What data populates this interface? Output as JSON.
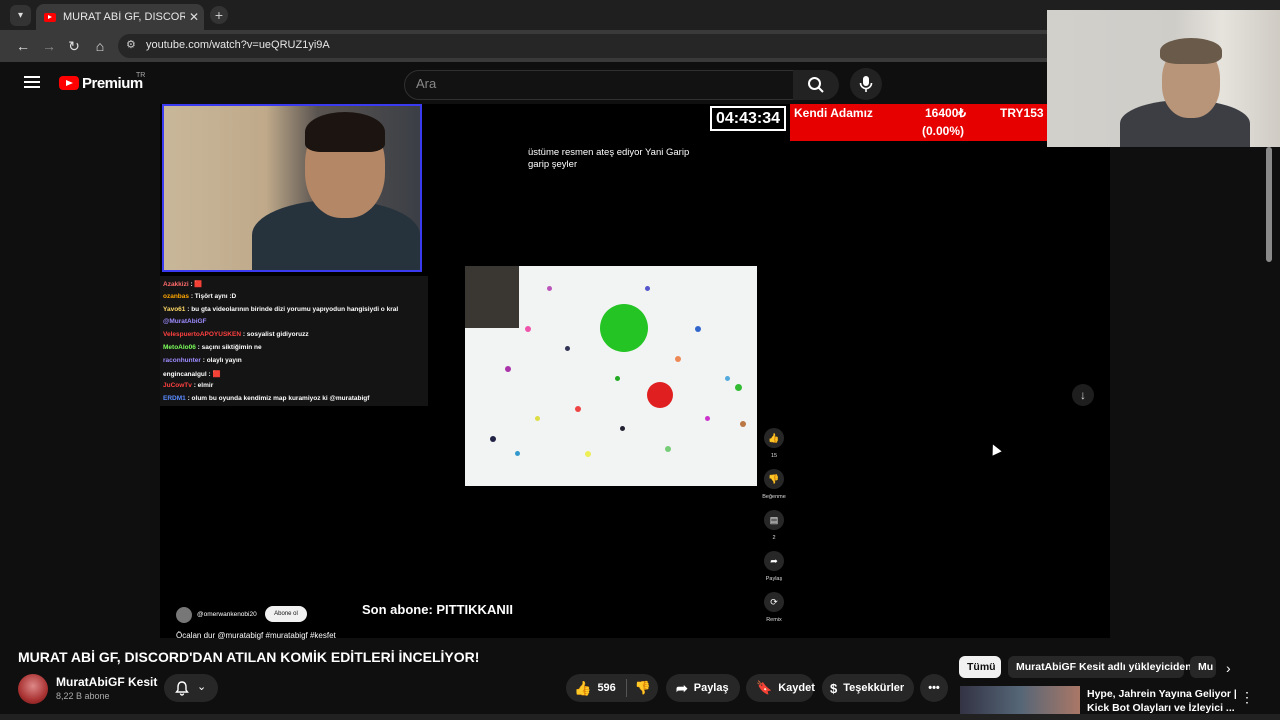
{
  "browser": {
    "tab_title": "MURAT ABİ GF, DISCORD'DAN AT...",
    "tab_close": "✕",
    "new_tab": "+",
    "url": "youtube.com/watch?v=ueQRUZ1yi9A",
    "back": "←",
    "forward": "→",
    "reload": "↻",
    "home": "⌂"
  },
  "header": {
    "brand": "Premium",
    "region": "TR",
    "search_placeholder": "Ara"
  },
  "overlay": {
    "timer": "04:43:34",
    "ticker_name": "Kendi Adamız",
    "ticker_value": "16400₺",
    "ticker_change": "(0.00%)",
    "ticker_currency": "TRY153"
  },
  "video": {
    "subtitle_line1": "üstüme resmen ateş ediyor Yani Garip",
    "subtitle_line2": "garip şeyler",
    "chat": [
      {
        "user": "Azakkizi",
        "text": " : 🟥",
        "color": "#ff6b6b"
      },
      {
        "user": "ozanbas",
        "text": " : Tişört aynı :D",
        "color": "#ffa500"
      },
      {
        "user": "Yavo61",
        "text": " : bu gta videolarının birinde dizi yorumu yapıyodun hangisiydi o kral",
        "color": "#ffd966"
      },
      {
        "user": "",
        "text": "@MuratAbiGF",
        "color": "#9d8cff"
      },
      {
        "user": "VelespuertoAPOYUSKEN",
        "text": " : sosyalist gidiyoruzz",
        "color": "#ff4040"
      },
      {
        "user": "MetoAlo06",
        "text": " : saçını siktiğimin ne",
        "color": "#7cff5a"
      },
      {
        "user": "raconhunter",
        "text": " : olaylı yayın",
        "color": "#9d8cff"
      },
      {
        "user": "engincanalgul",
        "text": " : 🟥",
        "color": "#ffffff"
      },
      {
        "user": "JuCowTv",
        "text": " : elmir",
        "color": "#ff4040"
      },
      {
        "user": "ERDM1",
        "text": " : olum bu oyunda kendimiz map kuramiyoz ki @muratabigf",
        "color": "#5a8cff"
      }
    ],
    "last_sub": "Son abone: PITTIKKANII",
    "shorts_channel": "@omerwankenobi20",
    "shorts_subscribe": "Abone ol",
    "shorts_desc": "Öcalan dur @muratabigf #muratabigf #kesfet",
    "side_like_count": "15",
    "side_dislike_label": "Beğenme",
    "side_comment_count": "2",
    "side_share_label": "Paylaş",
    "side_remix_label": "Remix"
  },
  "below": {
    "title": "MURAT ABİ GF, DISCORD'DAN ATILAN KOMİK EDİTLERİ İNCELİYOR!",
    "channel": "MuratAbiGF Kesit",
    "subscribers": "8,22 B abone",
    "likes": "596",
    "share": "Paylaş",
    "save": "Kaydet",
    "thanks": "Teşekkürler",
    "more": "•••"
  },
  "recommend": {
    "chips": [
      "Tümü",
      "MuratAbiGF Kesit adlı yükleyiciden",
      "Mu"
    ],
    "video_title_line1": "Hype, Jahrein Yayına Geliyor |",
    "video_title_line2": "Kick Bot Olayları ve İzleyici ..."
  },
  "colors": {
    "accent": "#ff0000",
    "ticker_bg": "#e60000",
    "background": "#0f0f0f"
  }
}
